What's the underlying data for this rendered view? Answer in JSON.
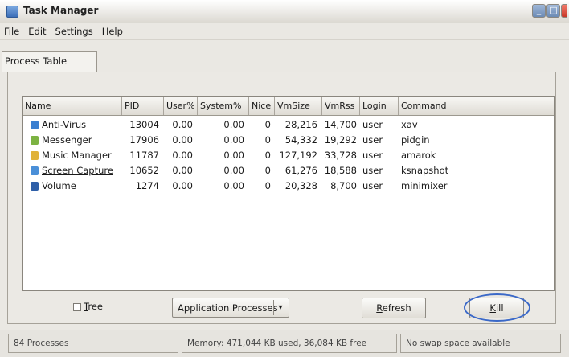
{
  "window": {
    "title": "Task Manager"
  },
  "menu": [
    {
      "label": "File"
    },
    {
      "label": "Edit"
    },
    {
      "label": "Settings"
    },
    {
      "label": "Help"
    }
  ],
  "tabs": [
    {
      "label": "Process Table"
    }
  ],
  "table": {
    "columns": [
      "Name",
      "PID",
      "User%",
      "System%",
      "Nice",
      "VmSize",
      "VmRss",
      "Login",
      "Command"
    ],
    "rows": [
      {
        "name": "Anti-Virus",
        "pid": "13004",
        "user": "0.00",
        "system": "0.00",
        "nice": "0",
        "vmsize": "28,216",
        "vmrss": "14,700",
        "login": "user",
        "command": "xav",
        "icon": "shield-icon",
        "icon_color": "#3a7fd0"
      },
      {
        "name": "Messenger",
        "pid": "17906",
        "user": "0.00",
        "system": "0.00",
        "nice": "0",
        "vmsize": "54,332",
        "vmrss": "19,292",
        "login": "user",
        "command": "pidgin",
        "icon": "chat-icon",
        "icon_color": "#7cb342"
      },
      {
        "name": "Music Manager",
        "pid": "11787",
        "user": "0.00",
        "system": "0.00",
        "nice": "0",
        "vmsize": "127,192",
        "vmrss": "33,728",
        "login": "user",
        "command": "amarok",
        "icon": "music-icon",
        "icon_color": "#e0b23a"
      },
      {
        "name": "Screen Capture",
        "pid": "10652",
        "user": "0.00",
        "system": "0.00",
        "nice": "0",
        "vmsize": "61,276",
        "vmrss": "18,588",
        "login": "user",
        "command": "ksnapshot",
        "icon": "camera-icon",
        "icon_color": "#4a8fd8"
      },
      {
        "name": "Volume",
        "pid": "1274",
        "user": "0.00",
        "system": "0.00",
        "nice": "0",
        "vmsize": "20,328",
        "vmrss": "8,700",
        "login": "user",
        "command": "minimixer",
        "icon": "speaker-icon",
        "icon_color": "#2e5fa8"
      }
    ]
  },
  "controls": {
    "tree_label": "Tree",
    "tree_checked": false,
    "filter_selected": "Application Processes",
    "refresh_label": "Refresh",
    "kill_label": "Kill"
  },
  "status": {
    "processes": "84 Processes",
    "memory": "Memory: 471,044 KB used, 36,084 KB free",
    "swap": "No swap space available"
  },
  "colors": {
    "highlight_ring": "#3b69c8"
  }
}
